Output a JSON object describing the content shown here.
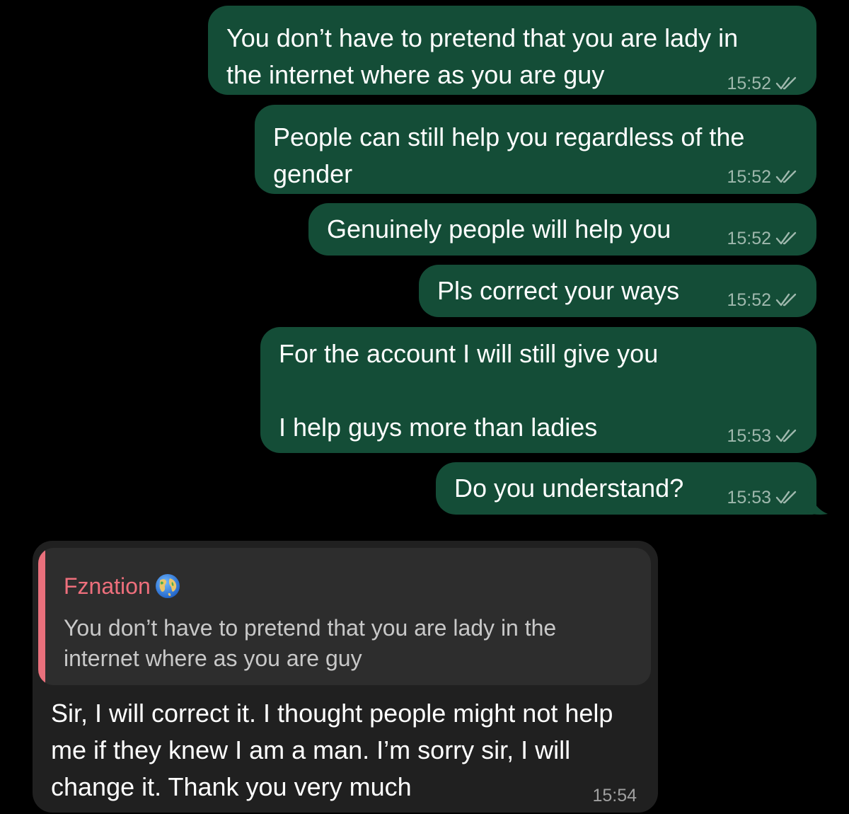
{
  "messages_out": [
    {
      "lines": [
        "You don’t have to pretend that you are lady in",
        "the internet where as you are guy"
      ],
      "time": "15:52",
      "status_icon": "double-check-icon"
    },
    {
      "lines": [
        "People can still help you regardless of the",
        "gender"
      ],
      "time": "15:52",
      "status_icon": "double-check-icon"
    },
    {
      "lines": [
        "Genuinely people will help you"
      ],
      "time": "15:52",
      "status_icon": "double-check-icon"
    },
    {
      "lines": [
        "Pls correct your ways"
      ],
      "time": "15:52",
      "status_icon": "double-check-icon"
    },
    {
      "lines": [
        "For the account I will still give you",
        "",
        "I help guys more than ladies"
      ],
      "time": "15:53",
      "status_icon": "double-check-icon"
    },
    {
      "lines": [
        "Do you understand?"
      ],
      "time": "15:53",
      "status_icon": "double-check-icon"
    }
  ],
  "message_in": {
    "quote": {
      "author": "Fznation",
      "author_icon": "globe-icon",
      "text": "You don’t have to pretend that you are lady in the internet where as you are guy"
    },
    "text": "Sir, I will correct it. I thought people might not help me if they knew I am a man. I’m sorry sir, I will change it. Thank you very much",
    "time": "15:54"
  },
  "colors": {
    "background": "#000000",
    "outgoing_bubble": "#144d37",
    "incoming_bubble": "#202020",
    "quote_background": "#2d2d2d",
    "quote_accent": "#e9707c",
    "outgoing_meta": "#9fb8ad"
  }
}
